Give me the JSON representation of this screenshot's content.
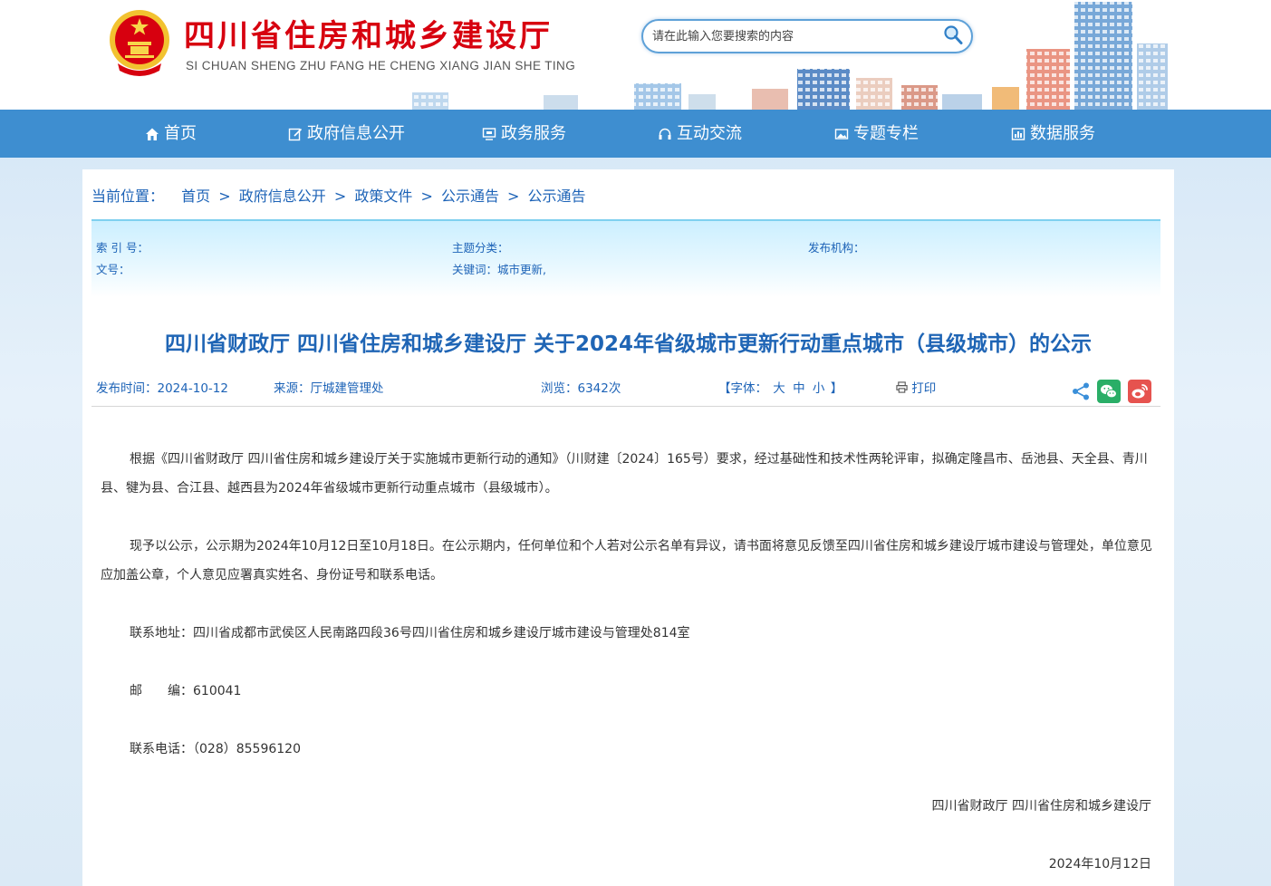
{
  "header": {
    "site_title": "四川省住房和城乡建设厅",
    "site_pinyin": "SI CHUAN SHENG ZHU FANG HE CHENG XIANG JIAN SHE TING",
    "search": {
      "placeholder": "请在此输入您要搜索的内容",
      "icon": "search-icon"
    },
    "emblem_icon": "national-emblem-icon"
  },
  "nav": {
    "items": [
      {
        "label": "首页",
        "icon": "home-icon"
      },
      {
        "label": "政府信息公开",
        "icon": "edit-icon"
      },
      {
        "label": "政务服务",
        "icon": "monitor-icon"
      },
      {
        "label": "互动交流",
        "icon": "headset-icon"
      },
      {
        "label": "专题专栏",
        "icon": "image-icon"
      },
      {
        "label": "数据服务",
        "icon": "chart-icon"
      }
    ],
    "color": "#3e8ed0"
  },
  "breadcrumb": {
    "label": "当前位置：",
    "items": [
      "首页",
      "政府信息公开",
      "政策文件",
      "公示通告",
      "公示通告"
    ],
    "separator": ">"
  },
  "meta": {
    "index_label": "索 引 号：",
    "index_value": "",
    "topic_label": "主题分类：",
    "topic_value": "",
    "publisher_label": "发布机构：",
    "publisher_value": "",
    "docno_label": "文号：",
    "docno_value": "",
    "keywords_label": "关键词：",
    "keywords_value": "城市更新,"
  },
  "article": {
    "title": "四川省财政厅 四川省住房和城乡建设厅 关于2024年省级城市更新行动重点城市（县级城市）的公示",
    "publish_time": "发布时间：2024-10-12",
    "source": "来源：厅城建管理处",
    "views": "浏览：6342次",
    "font_label_open": "【字体：",
    "font_large": "大",
    "font_medium": "中",
    "font_small": "小",
    "font_label_close": "】",
    "print_label": "打印",
    "paragraphs": [
      "根据《四川省财政厅 四川省住房和城乡建设厅关于实施城市更新行动的通知》（川财建〔2024〕165号）要求，经过基础性和技术性两轮评审，拟确定隆昌市、岳池县、天全县、青川县、犍为县、合江县、越西县为2024年省级城市更新行动重点城市（县级城市）。",
      "现予以公示，公示期为2024年10月12日至10月18日。在公示期内，任何单位和个人若对公示名单有异议，请书面将意见反馈至四川省住房和城乡建设厅城市建设与管理处，单位意见应加盖公章，个人意见应署真实姓名、身份证号和联系电话。",
      "联系地址：四川省成都市武侯区人民南路四段36号四川省住房和城乡建设厅城市建设与管理处814室",
      "邮　　编：610041",
      "联系电话：（028）85596120"
    ],
    "signature": "四川省财政厅 四川省住房和城乡建设厅",
    "date": "2024年10月12日"
  },
  "colors": {
    "title_red": "#d7000f",
    "link_blue": "#1d63b7",
    "wechat_green": "#2aae67",
    "weibo_red": "#e6534f"
  }
}
